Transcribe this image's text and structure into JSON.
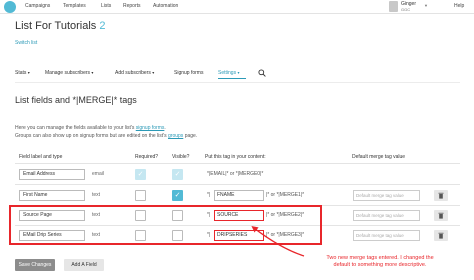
{
  "topnav": {
    "items": [
      "Campaigns",
      "Templates",
      "Lists",
      "Reports",
      "Automation"
    ],
    "help": "Help"
  },
  "user": {
    "name": "Ginger",
    "sub": "GGC"
  },
  "page": {
    "title": "List For Tutorials",
    "count": "2",
    "switch_list": "Switch list"
  },
  "tabs": [
    {
      "label": "Stats",
      "has_menu": true
    },
    {
      "label": "Manage subscribers",
      "has_menu": true
    },
    {
      "label": "Add subscribers",
      "has_menu": true
    },
    {
      "label": "Signup forms",
      "has_menu": false
    },
    {
      "label": "Settings",
      "has_menu": true,
      "active": true
    }
  ],
  "section": {
    "title": "List fields and *|MERGE|* tags",
    "desc_line1_pre": "Here you can manage the fields available to your list's",
    "desc_line1_link": "signup forms",
    "desc_line2_pre": "Groups can also show up on signup forms but are edited on the list's",
    "desc_line2_link": "groups",
    "desc_line2_post": "page."
  },
  "table": {
    "headers": {
      "field": "Field label and type",
      "required": "Required?",
      "visible": "Visible?",
      "tag": "Put this tag in your content:",
      "default": "Default merge tag value"
    },
    "rows": [
      {
        "label": "Email Address",
        "type": "email",
        "required": true,
        "visible": true,
        "tag_text": "*|EMAIL|* or *|MERGE0|*",
        "tag": "",
        "default": "",
        "editable_tag": false
      },
      {
        "label": "First Name",
        "type": "text",
        "required": false,
        "visible": true,
        "tag_prefix": "*|",
        "tag": "FNAME",
        "tag_suffix": "|* or *|MERGE1|*",
        "default": "Default merge tag value",
        "editable_tag": true
      },
      {
        "label": "Source Page",
        "type": "text",
        "required": false,
        "visible": false,
        "tag_prefix": "*|",
        "tag": "SOURCE",
        "tag_suffix": "|* or *|MERGE2|*",
        "default": "Default merge tag value",
        "editable_tag": true
      },
      {
        "label": "EMail Drip Series",
        "type": "text",
        "required": false,
        "visible": false,
        "tag_prefix": "*|",
        "tag": "DRIPSERIES",
        "tag_suffix": "|* or *|MERGE3|*",
        "default": "Default merge tag value",
        "editable_tag": true
      }
    ]
  },
  "annotation": {
    "line1": "Two new merge tags entered.  I changed the",
    "line2": "default to something more descriptive."
  },
  "buttons": {
    "save": "Save Changes",
    "add": "Add A Field"
  },
  "colors": {
    "accent": "#52bad5",
    "link": "#2c9ab7",
    "annotation": "#e8262b"
  }
}
